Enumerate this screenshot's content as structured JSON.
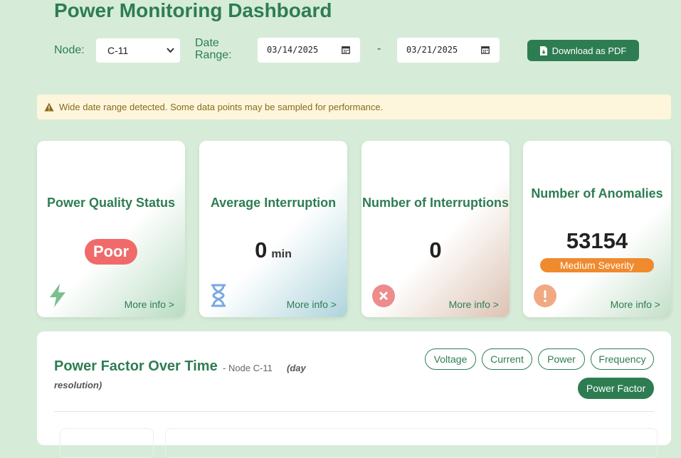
{
  "header": {
    "title": "Power Monitoring Dashboard"
  },
  "filters": {
    "node_label": "Node:",
    "node_value": "C-11",
    "date_label": "Date Range:",
    "start_date": "03/14/2025",
    "separator": "-",
    "end_date": "03/21/2025",
    "download_label": "Download as PDF"
  },
  "alert": {
    "text": "Wide date range detected. Some data points may be sampled for performance."
  },
  "cards": [
    {
      "title": "Power Quality Status",
      "value": "Poor",
      "more": "More info >",
      "icon": "lightning-icon"
    },
    {
      "title": "Average Interruption",
      "value": "0",
      "unit": "min",
      "more": "More info >",
      "icon": "hourglass-icon"
    },
    {
      "title": "Number of Interruptions",
      "value": "0",
      "more": "More info >",
      "icon": "x-circle-icon"
    },
    {
      "title": "Number of Anomalies",
      "value": "53154",
      "badge": "Medium Severity",
      "more": "More info >",
      "icon": "exclamation-circle-icon"
    }
  ],
  "chart_panel": {
    "title": "Power Factor Over Time",
    "subtitle": "- Node C-11",
    "resolution_1": "(day",
    "resolution_2": "resolution)",
    "tabs": [
      "Voltage",
      "Current",
      "Power",
      "Frequency",
      "Power Factor"
    ],
    "active_tab": "Power Factor"
  },
  "colors": {
    "brand": "#2e7d52",
    "background": "#d6ecd8",
    "poor": "#f06a6a",
    "severity": "#f08a2e",
    "alert_bg": "#fdf6dc"
  }
}
